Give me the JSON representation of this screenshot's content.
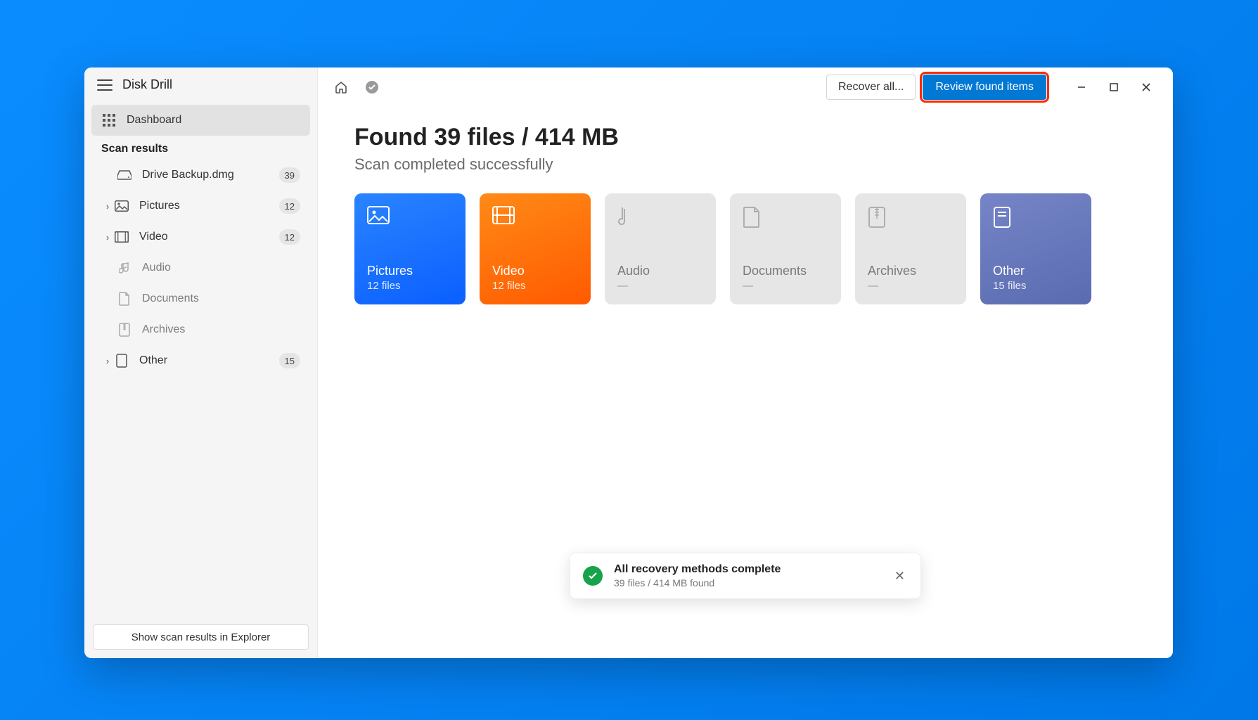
{
  "app_title": "Disk Drill",
  "sidebar": {
    "dashboard": "Dashboard",
    "section": "Scan results",
    "items": [
      {
        "label": "Drive Backup.dmg",
        "badge": "39"
      },
      {
        "label": "Pictures",
        "badge": "12"
      },
      {
        "label": "Video",
        "badge": "12"
      },
      {
        "label": "Audio",
        "badge": ""
      },
      {
        "label": "Documents",
        "badge": ""
      },
      {
        "label": "Archives",
        "badge": ""
      },
      {
        "label": "Other",
        "badge": "15"
      }
    ],
    "footer_button": "Show scan results in Explorer"
  },
  "toolbar": {
    "recover_all": "Recover all...",
    "review": "Review found items"
  },
  "main": {
    "headline": "Found 39 files / 414 MB",
    "subhead": "Scan completed successfully"
  },
  "cards": [
    {
      "title": "Pictures",
      "sub": "12 files"
    },
    {
      "title": "Video",
      "sub": "12 files"
    },
    {
      "title": "Audio",
      "sub": "—"
    },
    {
      "title": "Documents",
      "sub": "—"
    },
    {
      "title": "Archives",
      "sub": "—"
    },
    {
      "title": "Other",
      "sub": "15 files"
    }
  ],
  "toast": {
    "title": "All recovery methods complete",
    "sub": "39 files / 414 MB found"
  }
}
